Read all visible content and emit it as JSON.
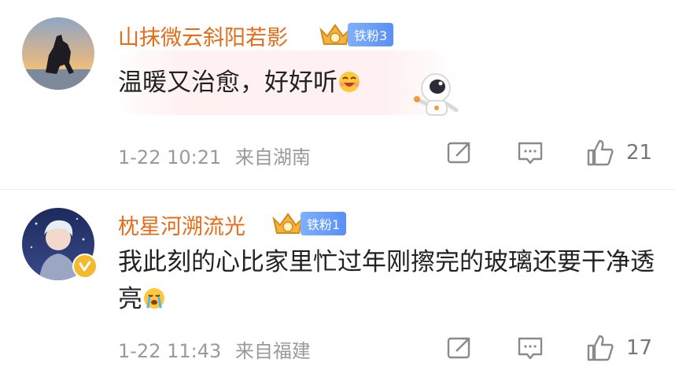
{
  "comments": [
    {
      "username": "山抹微云斜阳若影",
      "fan_badge": "铁粉3",
      "text": "温暖又治愈，好好听",
      "time": "1-22 10:21",
      "location": "来自湖南",
      "likes": "21",
      "icons": {
        "share": "share-icon",
        "comment": "comment-icon",
        "like": "like-icon"
      }
    },
    {
      "username": "枕星河溯流光",
      "fan_badge": "铁粉1",
      "text": "我此刻的心比家里忙过年刚擦完的玻璃还要干净透亮",
      "time": "1-22 11:43",
      "location": "来自福建",
      "likes": "17",
      "icons": {
        "share": "share-icon",
        "comment": "comment-icon",
        "like": "like-icon"
      }
    }
  ],
  "colors": {
    "username": "#e86b19",
    "fan_badge": "#5a8ff5",
    "meta": "#9a9a9a",
    "text": "#222222"
  }
}
